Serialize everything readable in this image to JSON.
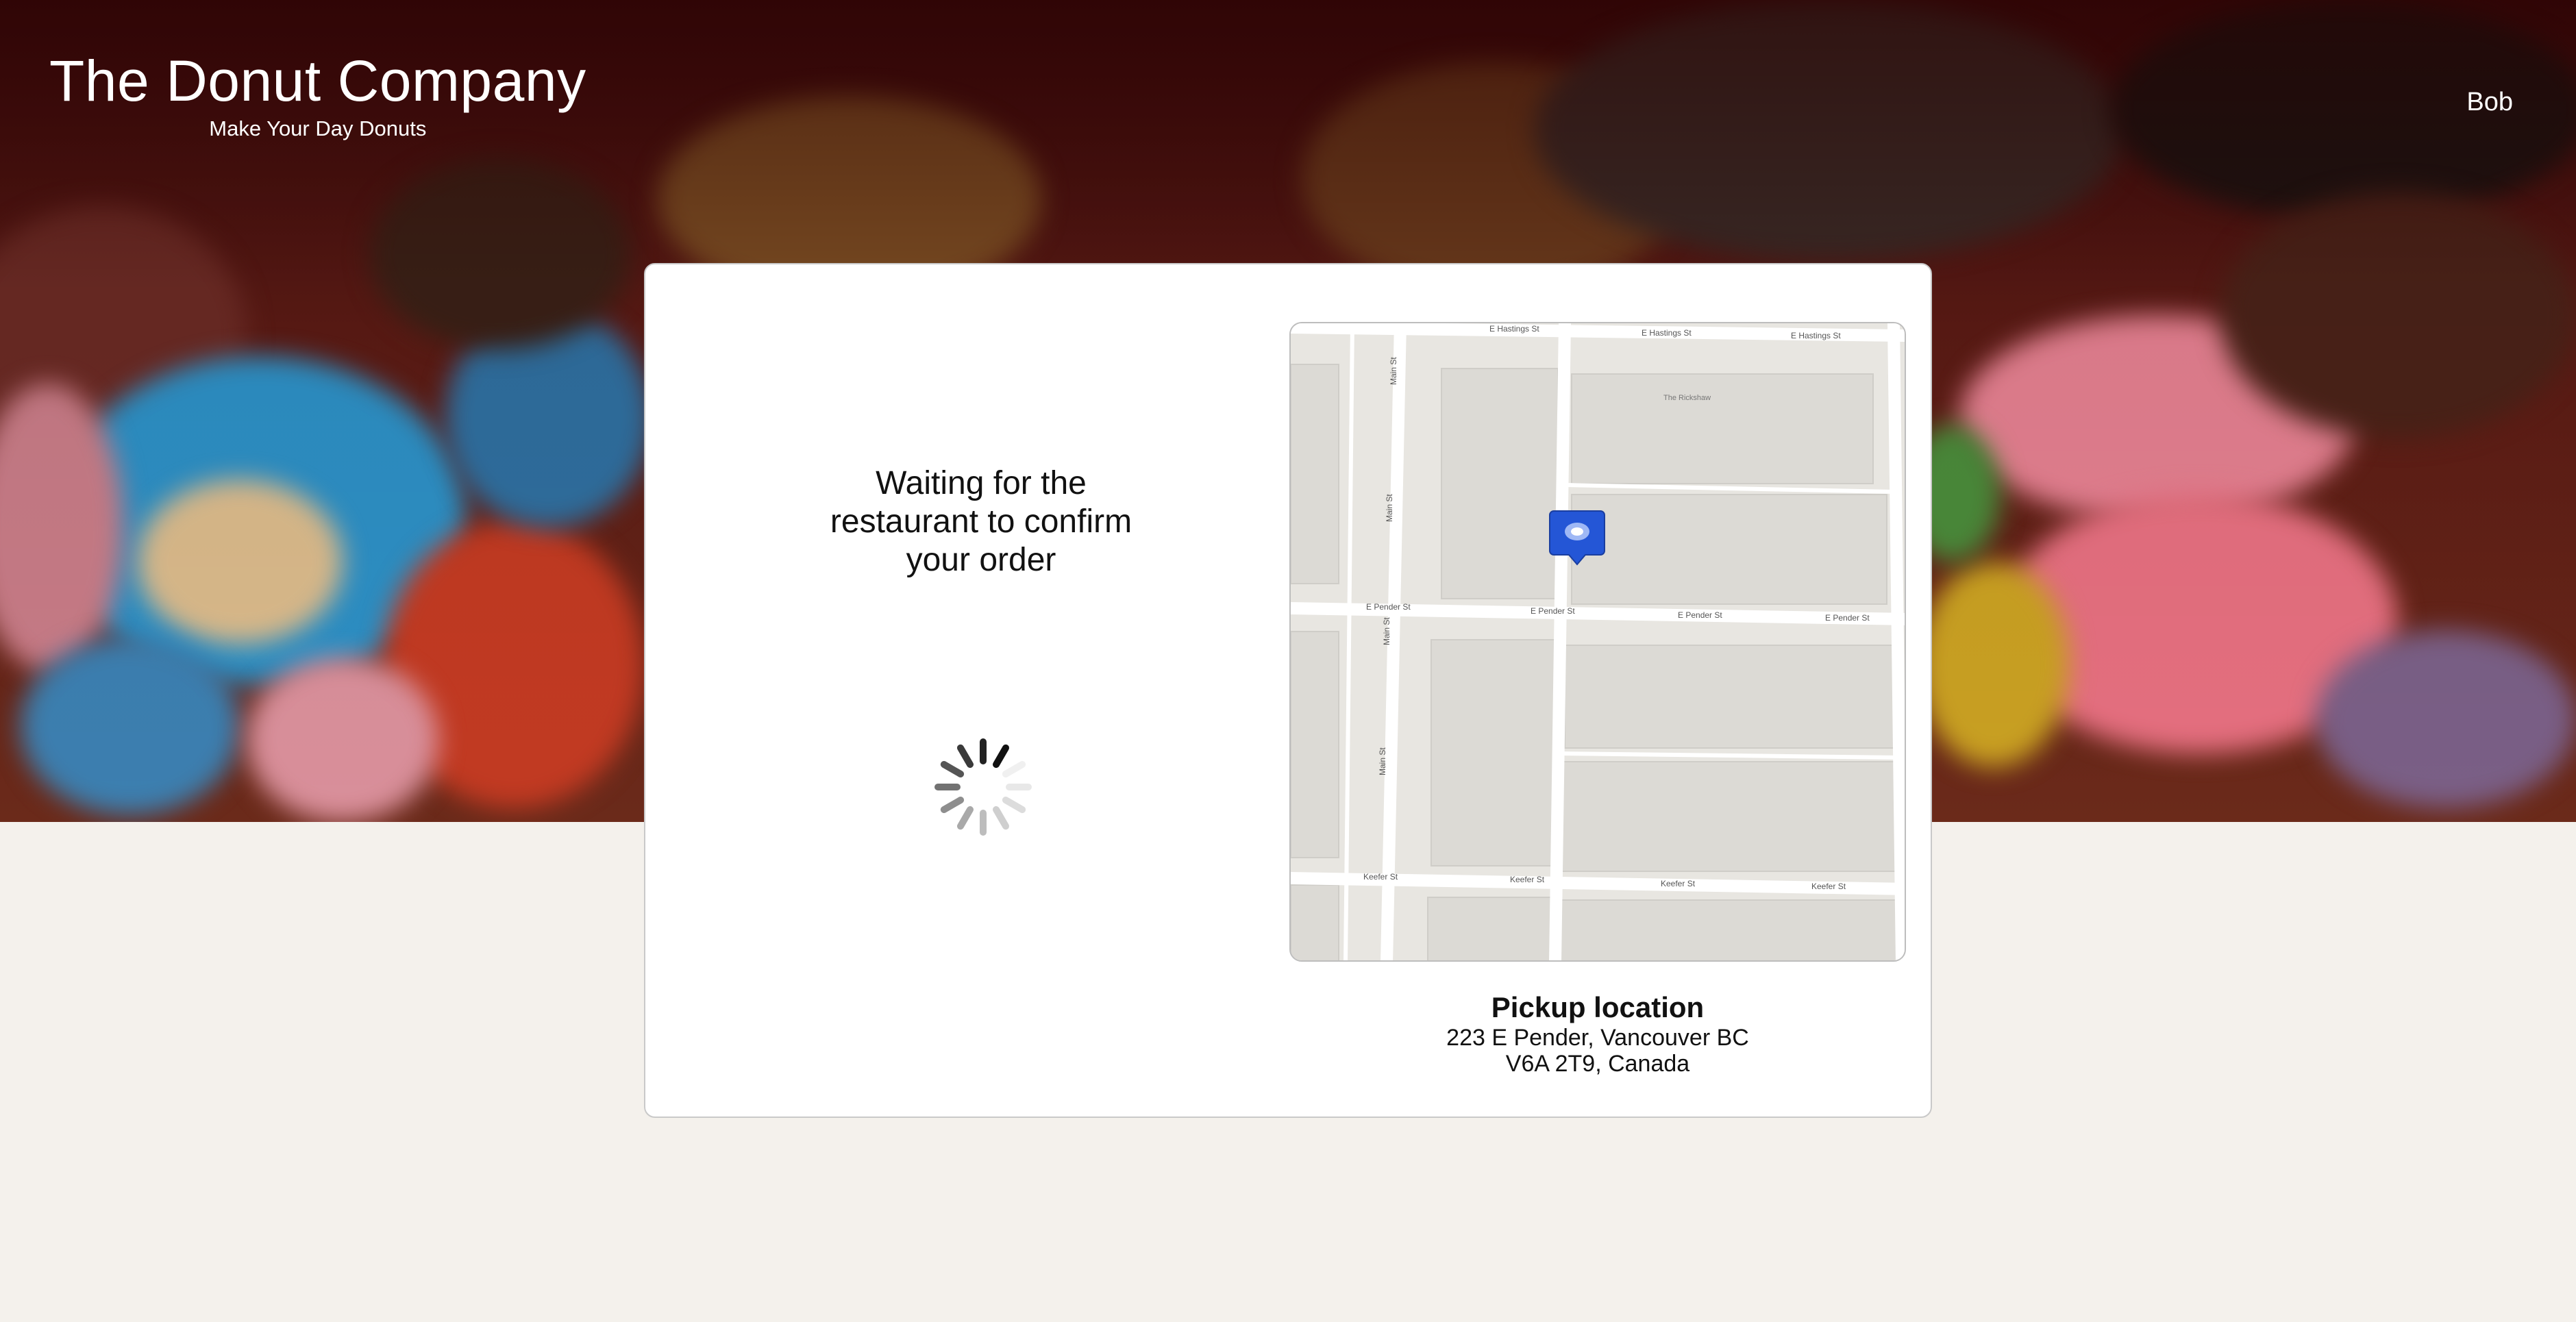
{
  "header": {
    "title": "The Donut Company",
    "tagline": "Make Your Day Donuts",
    "user_name": "Bob"
  },
  "order_status": {
    "message_line1": "Waiting for the",
    "message_line2": "restaurant to confirm",
    "message_line3": "your order"
  },
  "map": {
    "streets": {
      "hastings": "E Hastings St",
      "pender": "E Pender St",
      "keefer": "Keefer St",
      "main": "Main St"
    },
    "poi": "The Rickshaw"
  },
  "pickup": {
    "title": "Pickup location",
    "address_line1": "223 E Pender, Vancouver BC",
    "address_line2": "V6A 2T9, Canada"
  },
  "colors": {
    "page_bg": "#f4f1ec",
    "marker": "#2456d6",
    "text": "#111111"
  }
}
